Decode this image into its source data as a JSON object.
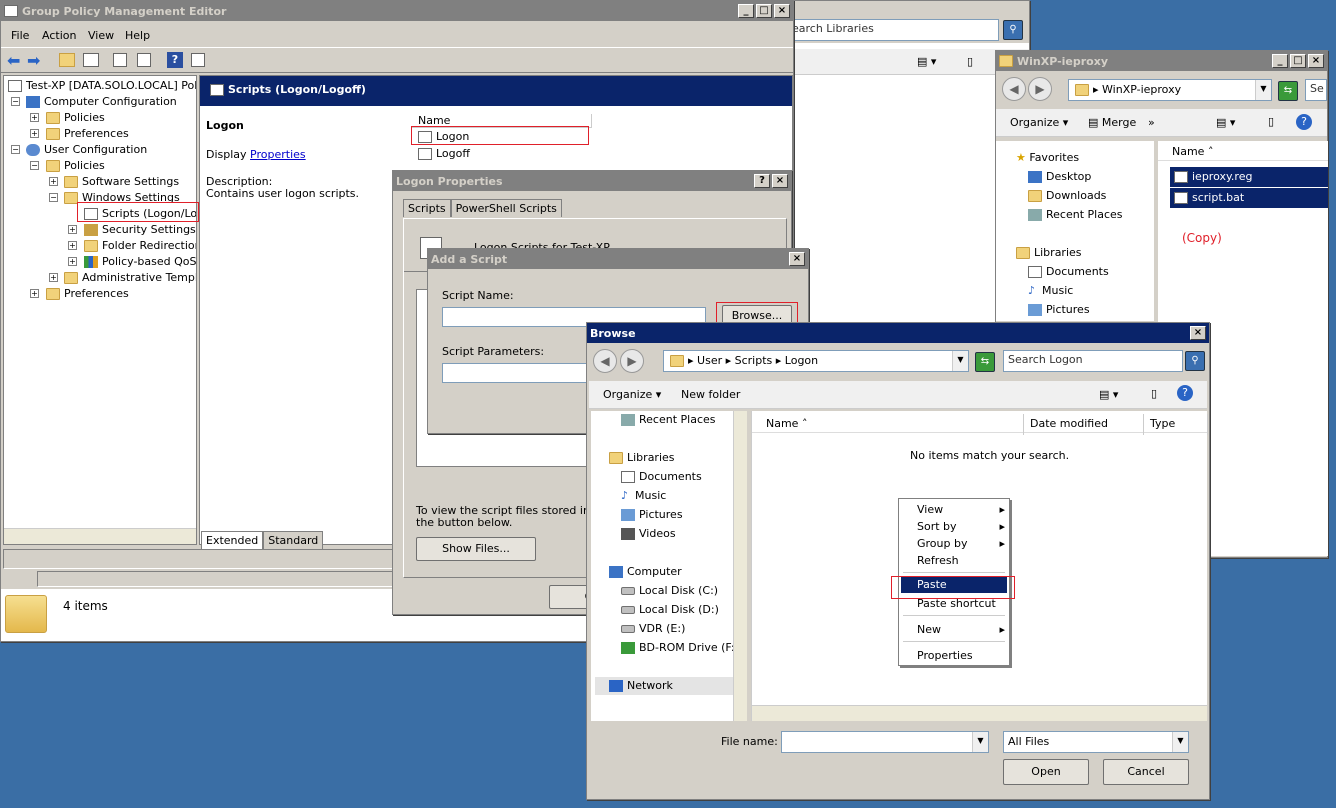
{
  "gpme": {
    "title": "Group Policy Management Editor",
    "menu": [
      "File",
      "Action",
      "View",
      "Help"
    ],
    "tree": [
      "Test-XP [DATA.SOLO.LOCAL] Polic",
      "Computer Configuration",
      "Policies",
      "Preferences",
      "User Configuration",
      "Policies",
      "Software Settings",
      "Windows Settings",
      "Scripts (Logon/Logo",
      "Security Settings",
      "Folder Redirection",
      "Policy-based QoS",
      "Administrative Templat",
      "Preferences"
    ],
    "header": "Scripts (Logon/Logoff)",
    "section": "Logon",
    "display": "Display",
    "properties_link": "Properties",
    "desc_label": "Description:",
    "desc": "Contains user logon scripts.",
    "list_header": "Name",
    "list": [
      "Logon",
      "Logoff"
    ],
    "tab_extended": "Extended",
    "tab_standard": "Standard",
    "items": "4 items"
  },
  "libraries": {
    "search": "earch Libraries"
  },
  "winxp": {
    "title": "WinXP-ieproxy",
    "crumb": "WinXP-ieproxy",
    "search": "Se",
    "organize": "Organize",
    "merge": "Merge",
    "more": "»",
    "nav": [
      "Favorites",
      "Desktop",
      "Downloads",
      "Recent Places",
      "Libraries",
      "Documents",
      "Music",
      "Pictures"
    ],
    "col_name": "Name",
    "files": [
      "ieproxy.reg",
      "script.bat"
    ],
    "note": "(Copy)"
  },
  "logon_props": {
    "title": "Logon Properties",
    "tabs": [
      "Scripts",
      "PowerShell Scripts"
    ],
    "heading": "Logon Scripts for Test-XP",
    "hint1": "To view the script files stored in this",
    "hint2": "the button below.",
    "show_files": "Show Files...",
    "ok": "O"
  },
  "add_script": {
    "title": "Add a Script",
    "name_label": "Script Name:",
    "browse": "Browse...",
    "params_label": "Script Parameters:"
  },
  "browse": {
    "title": "Browse",
    "crumb": [
      "User",
      "Scripts",
      "Logon"
    ],
    "search_placeholder": "Search Logon",
    "organize": "Organize",
    "new_folder": "New folder",
    "nav": [
      "Recent Places",
      "Libraries",
      "Documents",
      "Music",
      "Pictures",
      "Videos",
      "Computer",
      "Local Disk (C:)",
      "Local Disk (D:)",
      "VDR (E:)",
      "BD-ROM Drive (F:)",
      "Network"
    ],
    "cols": [
      "Name",
      "Date modified",
      "Type"
    ],
    "empty": "No items match your search.",
    "filename_label": "File name:",
    "filetype": "All Files",
    "open": "Open",
    "cancel": "Cancel"
  },
  "context_menu": [
    "View",
    "Sort by",
    "Group by",
    "Refresh",
    "Paste",
    "Paste shortcut",
    "New",
    "Properties"
  ]
}
